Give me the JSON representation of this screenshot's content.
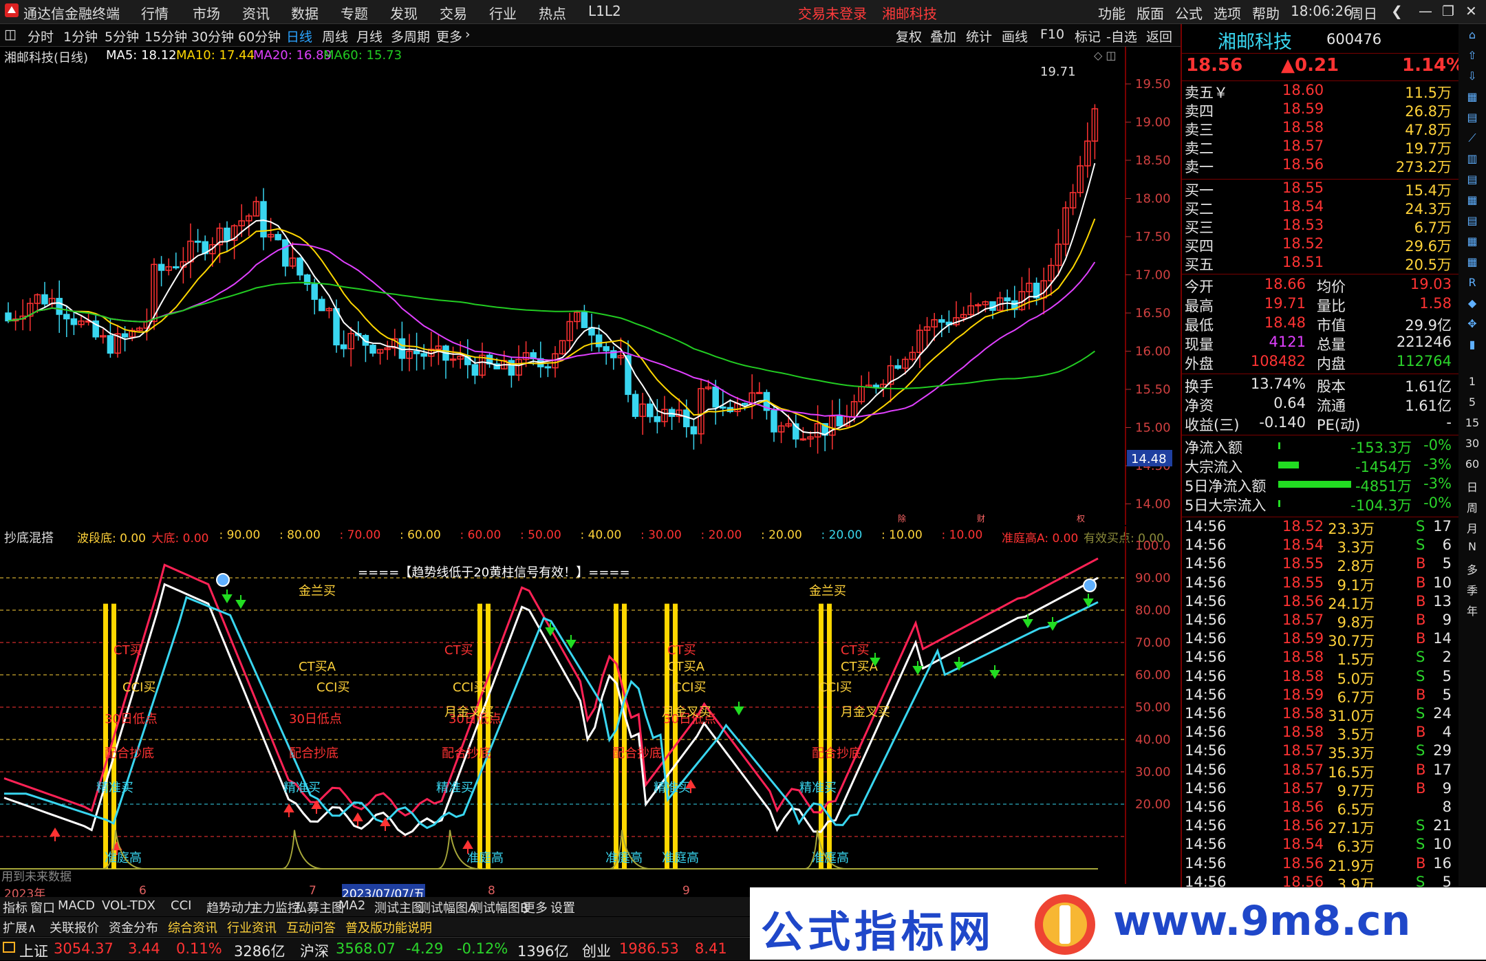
{
  "titlebar": {
    "app": "通达信金融终端",
    "menus": [
      "行情",
      "市场",
      "资讯",
      "数据",
      "专题",
      "发现",
      "交易",
      "行业",
      "热点",
      "L1L2"
    ],
    "trade_status": "交易未登录",
    "stock_name": "湘邮科技",
    "right_menus": [
      "功能",
      "版面",
      "公式",
      "选项",
      "帮助"
    ],
    "time": "18:06:26",
    "weekday": "周日"
  },
  "timeframes": {
    "items": [
      "分时",
      "1分钟",
      "5分钟",
      "15分钟",
      "30分钟",
      "60分钟",
      "日线",
      "周线",
      "月线",
      "多周期",
      "更多"
    ],
    "selected": "日线",
    "right_items": [
      "复权",
      "叠加",
      "统计",
      "画线",
      "F10",
      "标记",
      "-自选",
      "返回"
    ]
  },
  "main_chart": {
    "title": "湘邮科技(日线)",
    "ma_labels": [
      "MA5: 18.12",
      "MA10: 17.44",
      "MA20: 16.89",
      "MA60: 15.73"
    ],
    "ma_colors": [
      "#ffffff",
      "#ffd700",
      "#e040ff",
      "#22cc22"
    ],
    "price_axis": [
      "19.50",
      "19.00",
      "18.50",
      "18.00",
      "17.50",
      "17.00",
      "16.50",
      "16.00",
      "15.50",
      "15.00",
      "14.50",
      "14.00"
    ],
    "high_label": "19.71",
    "current_axis_price": "14.48",
    "event_markers": [
      "除",
      "财",
      "权"
    ]
  },
  "indicator": {
    "name": "抄底混搭",
    "legend": [
      {
        "text": "波段底: 0.00",
        "color": "#ffd23a"
      },
      {
        "text": "大底: 0.00",
        "color": "#ff3333"
      },
      {
        "text": ": 90.00",
        "color": "#ffd23a"
      },
      {
        "text": ": 80.00",
        "color": "#ffd23a"
      },
      {
        "text": ": 70.00",
        "color": "#ff3333"
      },
      {
        "text": ": 60.00",
        "color": "#ffd23a"
      },
      {
        "text": ": 60.00",
        "color": "#ff3333"
      },
      {
        "text": ": 50.00",
        "color": "#ff3333"
      },
      {
        "text": ": 40.00",
        "color": "#ffd23a"
      },
      {
        "text": ": 30.00",
        "color": "#ff3333"
      },
      {
        "text": ": 20.00",
        "color": "#ff3333"
      },
      {
        "text": ": 20.00",
        "color": "#ffd23a"
      },
      {
        "text": ": 20.00",
        "color": "#39d6f0"
      },
      {
        "text": ": 10.00",
        "color": "#ffd23a"
      },
      {
        "text": ": 10.00",
        "color": "#ff3333"
      },
      {
        "text": "准庭高A: 0.00",
        "color": "#ff3333"
      },
      {
        "text": "有效买点: 0.00",
        "color": "#8a8a3a"
      }
    ],
    "notice": "====【趋势线低于20黄柱信号有效！】====",
    "axis": [
      "100.0",
      "90.00",
      "80.00",
      "70.00",
      "60.00",
      "50.00",
      "40.00",
      "30.00",
      "20.00"
    ],
    "footnote": "用到未来数据",
    "signal_labels": {
      "golden": "金兰买",
      "ct": "CT买",
      "cta": "CT买A",
      "cci": "CCI买",
      "low30": "30日低点",
      "coop": "配合抄底",
      "precise": "精准买",
      "monthgold": "月金叉买",
      "zhuang": "准庭高"
    }
  },
  "date_axis": [
    "2023年",
    "6",
    "7",
    "2023/07/07/五",
    "8",
    "9"
  ],
  "bottom_tabs1": [
    "指标",
    "窗口",
    "MACD",
    "VOL-TDX",
    "CCI",
    "趋势动力",
    "主力监控",
    "私募主图",
    "MA2",
    "测试主图",
    "测试幅图A",
    "测试幅图B",
    "更多",
    "设置"
  ],
  "bottom_tabs2": [
    "扩展∧",
    "关联报价",
    "资金分布",
    "综合资讯",
    "行业资讯",
    "互动问答",
    "普及版功能说明"
  ],
  "quote": {
    "name": "湘邮科技",
    "code": "600476",
    "price": "18.56",
    "change": "▲0.21",
    "change_pct": "1.14%",
    "asks": [
      {
        "label": "卖五￥",
        "price": "18.60",
        "vol": "11.5万"
      },
      {
        "label": "卖四",
        "price": "18.59",
        "vol": "26.8万"
      },
      {
        "label": "卖三",
        "price": "18.58",
        "vol": "47.8万"
      },
      {
        "label": "卖二",
        "price": "18.57",
        "vol": "19.7万"
      },
      {
        "label": "卖一",
        "price": "18.56",
        "vol": "273.2万"
      }
    ],
    "bids": [
      {
        "label": "买一",
        "price": "18.55",
        "vol": "15.4万"
      },
      {
        "label": "买二",
        "price": "18.54",
        "vol": "24.3万"
      },
      {
        "label": "买三",
        "price": "18.53",
        "vol": "6.7万"
      },
      {
        "label": "买四",
        "price": "18.52",
        "vol": "29.6万"
      },
      {
        "label": "买五",
        "price": "18.51",
        "vol": "20.5万"
      }
    ],
    "stats": [
      {
        "l1": "今开",
        "v1": "18.66",
        "c1": "red",
        "l2": "均价",
        "v2": "19.03",
        "c2": "red"
      },
      {
        "l1": "最高",
        "v1": "19.71",
        "c1": "red",
        "l2": "量比",
        "v2": "1.58",
        "c2": "red"
      },
      {
        "l1": "最低",
        "v1": "18.48",
        "c1": "red",
        "l2": "市值",
        "v2": "29.9亿",
        "c2": "white"
      },
      {
        "l1": "现量",
        "v1": "4121",
        "c1": "magenta",
        "l2": "总量",
        "v2": "221246",
        "c2": "white"
      },
      {
        "l1": "外盘",
        "v1": "108482",
        "c1": "red",
        "l2": "内盘",
        "v2": "112764",
        "c2": "green"
      }
    ],
    "stats2": [
      {
        "l1": "换手",
        "v1": "13.74%",
        "l2": "股本",
        "v2": "1.61亿"
      },
      {
        "l1": "净资",
        "v1": "0.64",
        "l2": "流通",
        "v2": "1.61亿"
      },
      {
        "l1": "收益(三)",
        "v1": "-0.140",
        "l2": "PE(动)",
        "v2": "-"
      }
    ],
    "flows": [
      {
        "label": "净流入额",
        "value": "-153.3万",
        "pct": "-0%",
        "bar": 0.01
      },
      {
        "label": "大宗流入",
        "value": "-1454万",
        "pct": "-3%",
        "bar": 0.28
      },
      {
        "label": "5日净流入额",
        "value": "-4851万",
        "pct": "-3%",
        "bar": 1.0
      },
      {
        "label": "5日大宗流入",
        "value": "-104.3万",
        "pct": "-0%",
        "bar": 0.01
      }
    ],
    "ticks": [
      {
        "t": "14:56",
        "p": "18.52",
        "v": "23.3万",
        "s": "S",
        "n": "17"
      },
      {
        "t": "14:56",
        "p": "18.54",
        "v": "3.3万",
        "s": "S",
        "n": "6"
      },
      {
        "t": "14:56",
        "p": "18.55",
        "v": "2.8万",
        "s": "B",
        "n": "5"
      },
      {
        "t": "14:56",
        "p": "18.55",
        "v": "9.1万",
        "s": "B",
        "n": "10"
      },
      {
        "t": "14:56",
        "p": "18.56",
        "v": "24.1万",
        "s": "B",
        "n": "13"
      },
      {
        "t": "14:56",
        "p": "18.57",
        "v": "9.8万",
        "s": "B",
        "n": "9"
      },
      {
        "t": "14:56",
        "p": "18.59",
        "v": "30.7万",
        "s": "B",
        "n": "14"
      },
      {
        "t": "14:56",
        "p": "18.58",
        "v": "1.5万",
        "s": "S",
        "n": "2"
      },
      {
        "t": "14:56",
        "p": "18.58",
        "v": "5.0万",
        "s": "S",
        "n": "5"
      },
      {
        "t": "14:56",
        "p": "18.59",
        "v": "6.7万",
        "s": "B",
        "n": "5"
      },
      {
        "t": "14:56",
        "p": "18.58",
        "v": "31.0万",
        "s": "S",
        "n": "24"
      },
      {
        "t": "14:56",
        "p": "18.58",
        "v": "3.5万",
        "s": "B",
        "n": "4"
      },
      {
        "t": "14:56",
        "p": "18.57",
        "v": "35.3万",
        "s": "S",
        "n": "29"
      },
      {
        "t": "14:56",
        "p": "18.57",
        "v": "16.5万",
        "s": "B",
        "n": "17"
      },
      {
        "t": "14:56",
        "p": "18.57",
        "v": "9.7万",
        "s": "B",
        "n": "9"
      },
      {
        "t": "14:56",
        "p": "18.56",
        "v": "6.5万",
        "s": "",
        "n": "8"
      },
      {
        "t": "14:56",
        "p": "18.56",
        "v": "27.1万",
        "s": "S",
        "n": "21"
      },
      {
        "t": "14:56",
        "p": "18.54",
        "v": "6.3万",
        "s": "S",
        "n": "10"
      },
      {
        "t": "14:56",
        "p": "18.56",
        "v": "21.9万",
        "s": "B",
        "n": "16"
      },
      {
        "t": "14:56",
        "p": "18.56",
        "v": "3.9万",
        "s": "S",
        "n": "5"
      }
    ]
  },
  "side_tools": [
    "1",
    "5",
    "15",
    "30",
    "60",
    "日",
    "周",
    "月",
    "N",
    "多",
    "季",
    "年"
  ],
  "index_bar": [
    {
      "name": "上证",
      "value": "3054.37",
      "chg": "3.44",
      "pct": "0.11%",
      "amt": "3286亿",
      "color": "red"
    },
    {
      "name": "沪深",
      "value": "3568.07",
      "chg": "-4.29",
      "pct": "-0.12%",
      "amt": "1396亿",
      "color": "green"
    },
    {
      "name": "创业",
      "value": "1986.53",
      "chg": "8.41",
      "pct": "",
      "amt": "",
      "color": "red"
    }
  ],
  "watermark": {
    "text1": "公式指标网",
    "text2": "www.9m8.cn",
    "brand_color": "#1f47c9"
  },
  "colors": {
    "up": "#ff3333",
    "down": "#39d6f0",
    "panel_border": "#7a0000",
    "selected_tab": "#2aa3ff"
  }
}
